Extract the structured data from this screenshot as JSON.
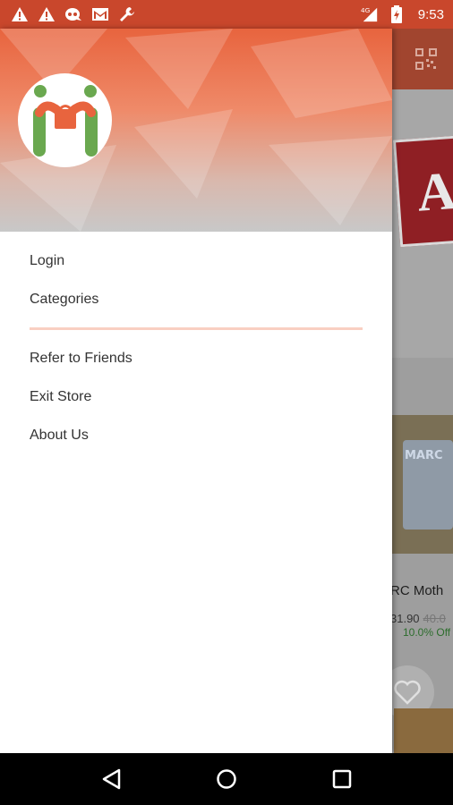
{
  "status_bar": {
    "time": "9:53",
    "network": "4G",
    "icons": [
      "warning-icon",
      "warning-icon",
      "voicemail-icon",
      "gmail-icon",
      "wrench-icon",
      "signal-icon",
      "battery-icon"
    ]
  },
  "drawer": {
    "menu": [
      {
        "label": "Login"
      },
      {
        "label": "Categories"
      }
    ],
    "menu_secondary": [
      {
        "label": "Refer to Friends"
      },
      {
        "label": "Exit Store"
      },
      {
        "label": "About Us"
      }
    ]
  },
  "background_app": {
    "banner_letter": "A",
    "product_brand": "MARC",
    "product_name": "RC Moth",
    "product_price": "31.90",
    "product_old_price": "40.0",
    "product_discount": "10.0% Off"
  },
  "colors": {
    "status_bar": "#c9472c",
    "accent": "#e8643e",
    "divider": "#f9cfc2",
    "logo_green": "#6aa84f",
    "logo_orange": "#e8643e"
  }
}
